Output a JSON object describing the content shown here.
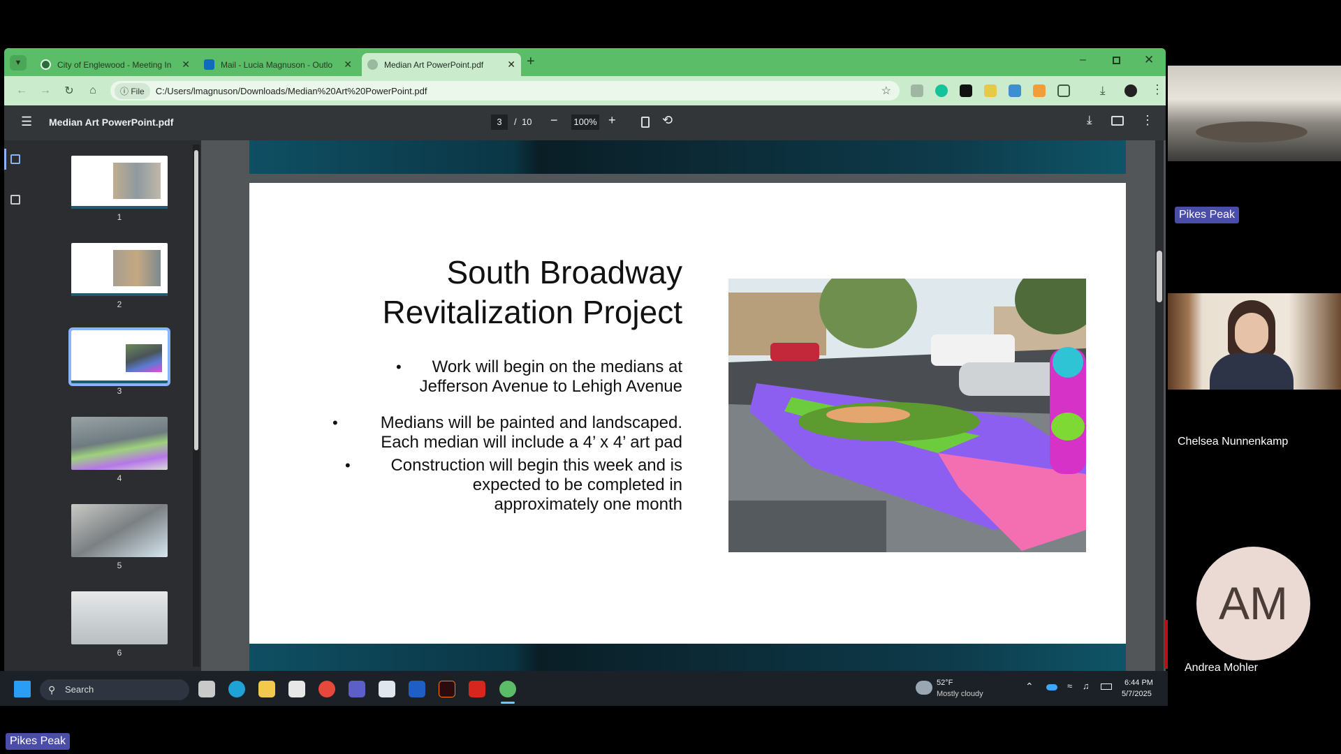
{
  "browser": {
    "tabs": [
      {
        "title": "City of Englewood - Meeting In",
        "active": false
      },
      {
        "title": "Mail - Lucia Magnuson - Outlo",
        "active": false
      },
      {
        "title": "Median Art PowerPoint.pdf",
        "active": true
      }
    ],
    "new_tab_label": "+",
    "address_chip": "File",
    "address_url": "C:/Users/lmagnuson/Downloads/Median%20Art%20PowerPoint.pdf"
  },
  "pdf": {
    "filename": "Median Art PowerPoint.pdf",
    "current_page": "3",
    "page_separator": "/",
    "total_pages": "10",
    "zoom": "100%",
    "thumbnails": [
      {
        "number": "1"
      },
      {
        "number": "2"
      },
      {
        "number": "3",
        "selected": true
      },
      {
        "number": "4"
      },
      {
        "number": "5"
      },
      {
        "number": "6"
      }
    ]
  },
  "slide": {
    "title_line1": "South Broadway",
    "title_line2": "Revitalization Project",
    "bullets": [
      {
        "line1": "Work will begin on the medians at",
        "line2": "Jefferson Avenue to Lehigh Avenue"
      },
      {
        "line1": "Medians will be painted and landscaped.",
        "line2": "Each median will include a 4’ x 4’ art pad"
      },
      {
        "line1": "Construction will begin this week and is",
        "line2": "expected to be completed in",
        "line3": "approximately one month"
      }
    ]
  },
  "taskbar": {
    "search_placeholder": "Search",
    "weather_temp": "52°F",
    "weather_desc": "Mostly cloudy",
    "time": "6:44 PM",
    "date": "5/7/2025"
  },
  "meeting": {
    "participants": [
      {
        "name": "Pikes Peak"
      },
      {
        "name": "Chelsea Nunnenkamp"
      },
      {
        "name": "Andrea Mohler",
        "initials": "AM"
      }
    ],
    "bottom_label": "Pikes Peak"
  }
}
